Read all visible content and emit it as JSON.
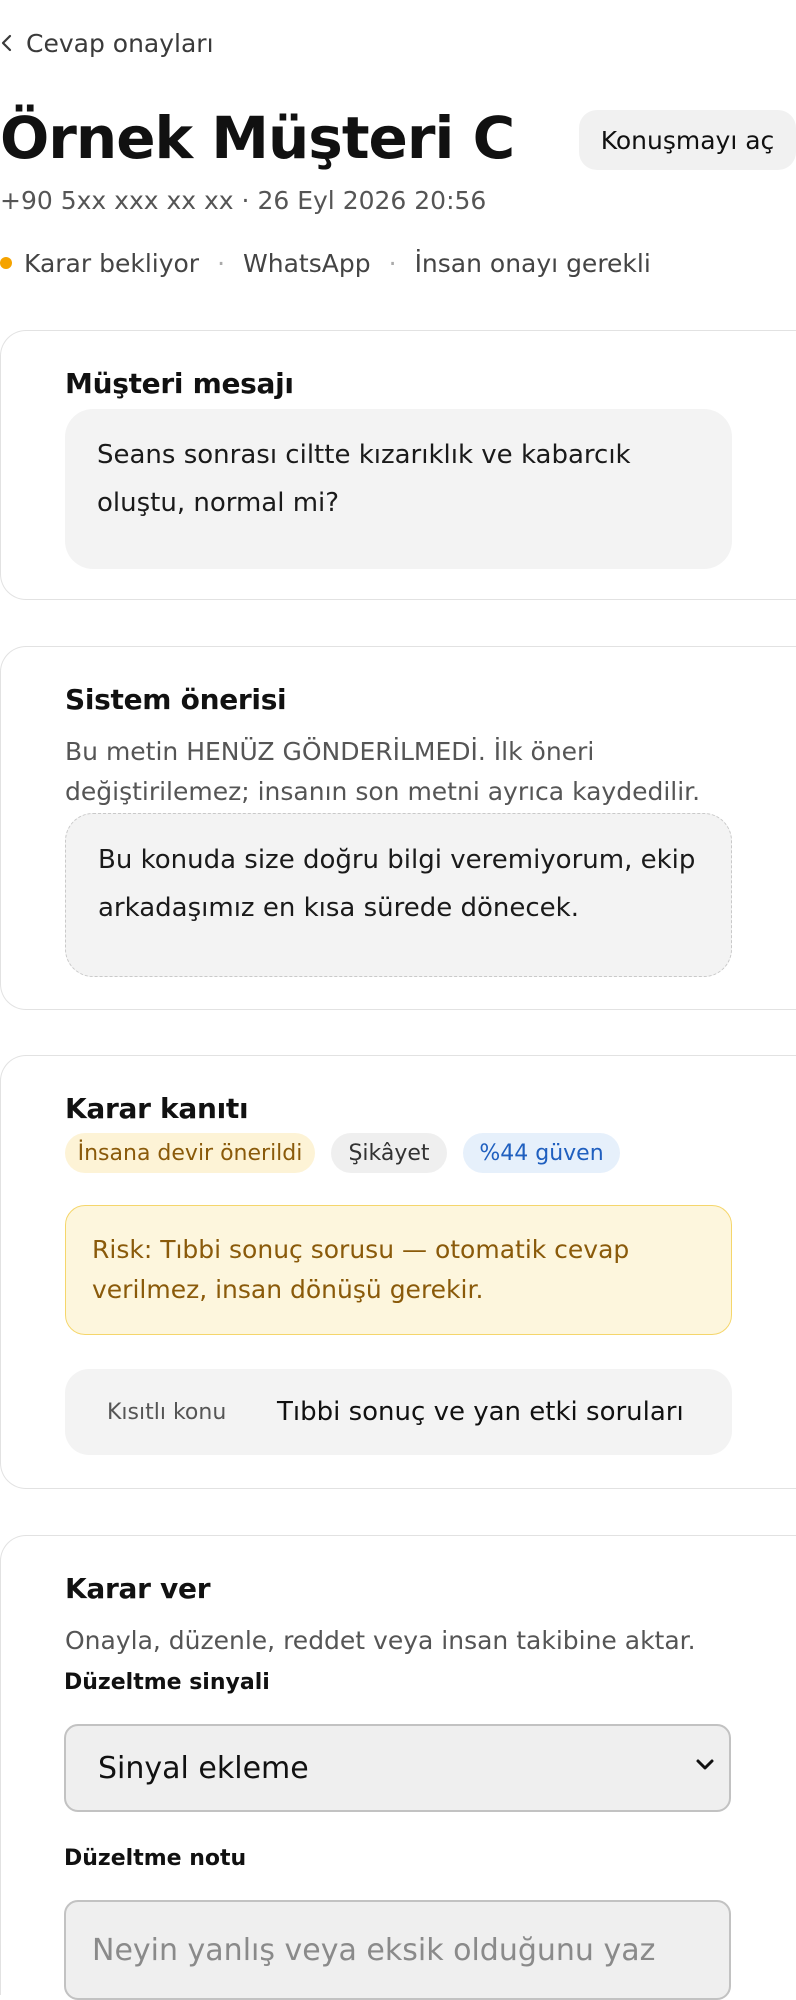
{
  "nav": {
    "back_label": "Cevap onayları"
  },
  "header": {
    "title": "Örnek Müşteri C",
    "open_conversation_label": "Konuşmayı aç",
    "subtitle": "+90 5xx xxx xx xx · 26 Eyl 2026 20:56",
    "status": "Karar bekliyor",
    "channel": "WhatsApp",
    "requirement": "İnsan onayı gerekli",
    "separator": "·"
  },
  "customer_message": {
    "title": "Müşteri mesajı",
    "text": "Seans sonrası ciltte kızarıklık ve kabarcık oluştu, normal mi?"
  },
  "system_suggestion": {
    "title": "Sistem önerisi",
    "description": "Bu metin HENÜZ GÖNDERİLMEDİ. İlk öneri değiştirilemez; insanın son metni ayrıca kaydedilir.",
    "text": "Bu konuda size doğru bilgi veremiyorum, ekip arkadaşımız en kısa sürede dönecek."
  },
  "decision_evidence": {
    "title": "Karar kanıtı",
    "chips": {
      "handover": "İnsana devir önerildi",
      "category": "Şikâyet",
      "confidence": "%44 güven"
    },
    "risk_text": "Risk: Tıbbi sonuç sorusu — otomatik cevap verilmez, insan dönüşü gerekir.",
    "restricted_topic_key": "Kısıtlı konu",
    "restricted_topic_value": "Tıbbi sonuç ve yan etki soruları"
  },
  "decide": {
    "title": "Karar ver",
    "description": "Onayla, düzenle, reddet veya insan takibine aktar.",
    "signal_label": "Düzeltme sinyali",
    "signal_value": "Sinyal ekleme",
    "note_label": "Düzeltme notu",
    "note_placeholder": "Neyin yanlış veya eksik olduğunu yaz"
  },
  "colors": {
    "status_dot": "#f5a300",
    "handover_bg": "#fdf3d6",
    "handover_text": "#8a5a0a",
    "category_bg": "#efefef",
    "confidence_bg": "#e6f0fb",
    "confidence_text": "#1f5fbf"
  }
}
